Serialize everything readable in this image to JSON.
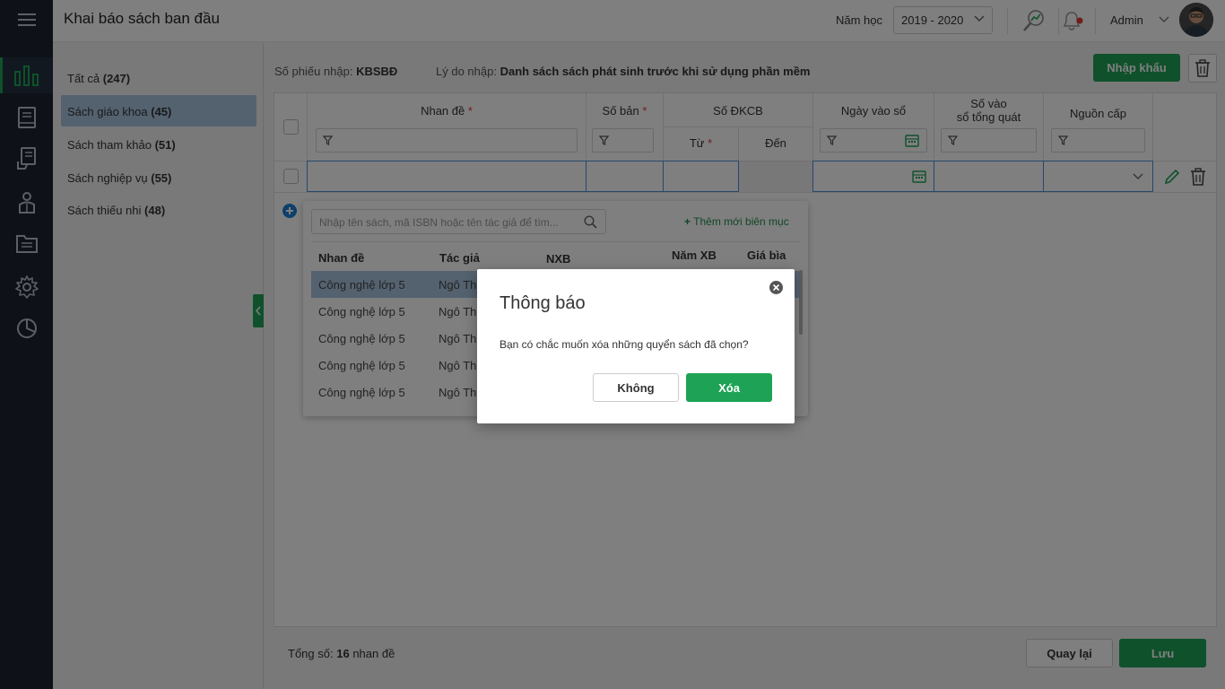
{
  "header": {
    "title": "Khai báo sách ban đầu",
    "year_label": "Năm học",
    "year_value": "2019 - 2020",
    "user_name": "Admin"
  },
  "categories": [
    {
      "name": "Tất cả",
      "count": "(247)",
      "active": false
    },
    {
      "name": "Sách giáo khoa",
      "count": "(45)",
      "active": true
    },
    {
      "name": "Sách tham khảo",
      "count": "(51)",
      "active": false
    },
    {
      "name": "Sách nghiệp vụ",
      "count": "(55)",
      "active": false
    },
    {
      "name": "Sách thiếu nhi",
      "count": "(48)",
      "active": false
    }
  ],
  "info": {
    "voucher_label": "Số phiếu nhập:",
    "voucher_value": "KBSBĐ",
    "reason_label": "Lý do nhập:",
    "reason_value": "Danh sách sách phát sinh trước khi sử dụng phần mềm",
    "import_button": "Nhập khẩu"
  },
  "grid": {
    "columns": {
      "title": "Nhan đề",
      "copies": "Số bản",
      "dkcb": "Số ĐKCB",
      "from": "Từ",
      "to": "Đến",
      "date": "Ngày vào sổ",
      "general_line1": "Số vào",
      "general_line2": "sổ tổng quát",
      "source": "Nguồn cấp"
    },
    "required_mark": "*"
  },
  "popup": {
    "search_placeholder": "Nhập tên sách, mã ISBN hoặc tên tác giả để tìm...",
    "add_new": "Thêm mới biên mục",
    "headers": {
      "title": "Nhan đề",
      "author": "Tác giả",
      "publisher": "NXB",
      "year": "Năm XB",
      "price": "Giá bìa"
    },
    "rows": [
      {
        "title": "Công nghệ lớp 5",
        "author": "Ngô Th"
      },
      {
        "title": "Công nghệ lớp 5",
        "author": "Ngô Th"
      },
      {
        "title": "Công nghệ lớp 5",
        "author": "Ngô Th"
      },
      {
        "title": "Công nghệ lớp 5",
        "author": "Ngô Th"
      },
      {
        "title": "Công nghệ lớp 5",
        "author": "Ngô Th"
      }
    ]
  },
  "footer": {
    "total_label": "Tổng số:",
    "total_value": "16",
    "total_unit": "nhan đề",
    "back_button": "Quay lại",
    "save_button": "Lưu"
  },
  "dialog": {
    "title": "Thông báo",
    "message": "Bạn có chắc muốn xóa những quyển sách đã chọn?",
    "cancel_button": "Không",
    "confirm_button": "Xóa"
  },
  "colors": {
    "accent_green": "#1ea356",
    "rail_bg": "#1c2430",
    "selection_blue": "#a9c4e0"
  }
}
